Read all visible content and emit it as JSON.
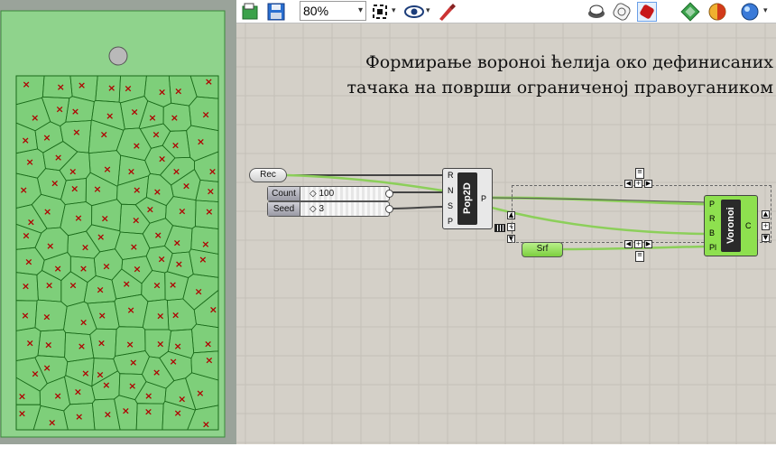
{
  "toolbar": {
    "zoom": "80%",
    "icons": [
      "open-file-icon",
      "save-icon",
      "zoom-dropdown",
      "zoom-extents-icon",
      "preview-eye-icon",
      "sketch-icon",
      "preview-wire-icon",
      "preview-shaded-icon",
      "preview-selected-icon",
      "bake-icon",
      "material-icon",
      "sphere-display-icon"
    ]
  },
  "caption": {
    "line1": "Формирање вороноi ћелија око дефинисаних",
    "line2": "тачака на површи ограниченој правоугаником"
  },
  "nodes": {
    "rec": {
      "label": "Rec"
    },
    "count": {
      "label": "Count",
      "value": "◇ 100"
    },
    "seed": {
      "label": "Seed",
      "value": "◇ 3"
    },
    "pop2d": {
      "name": "Pop2D",
      "inputs": [
        "R",
        "N",
        "S",
        "P"
      ],
      "output": "P"
    },
    "srf": {
      "label": "Srf"
    },
    "voronoi": {
      "name": "Voronoi",
      "inputs": [
        "P",
        "R",
        "B",
        "Pl"
      ],
      "output": "C"
    }
  },
  "colors": {
    "panel_fill": "#8fd38c",
    "point_marker": "#b00000",
    "cell_line": "#1a6b1a",
    "component_green": "#8ee04f",
    "wire_green": "#8ccf5a"
  }
}
